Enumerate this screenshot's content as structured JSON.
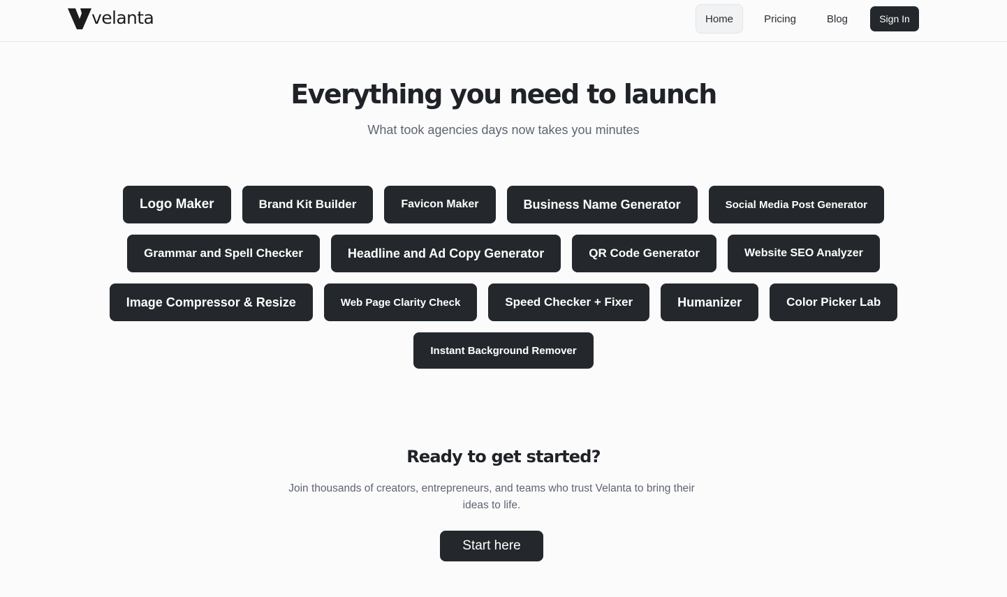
{
  "brand": {
    "name": "velanta",
    "logo_icon": "velanta-v-mark-icon"
  },
  "nav": {
    "home": "Home",
    "pricing": "Pricing",
    "blog": "Blog",
    "sign_in": "Sign In"
  },
  "hero": {
    "title": "Everything you need to launch",
    "subtitle": "What took agencies days now takes you minutes"
  },
  "tools": [
    "Logo Maker",
    "Brand Kit Builder",
    "Favicon Maker",
    "Business Name Generator",
    "Social Media Post Generator",
    "Grammar and Spell Checker",
    "Headline and Ad Copy Generator",
    "QR Code Generator",
    "Website SEO Analyzer",
    "Image Compressor & Resize",
    "Web Page Clarity Check",
    "Speed Checker + Fixer",
    "Humanizer",
    "Color Picker Lab",
    "Instant Background Remover"
  ],
  "cta": {
    "title": "Ready to get started?",
    "text": "Join thousands of creators, entrepreneurs, and teams who trust Velanta to bring their ideas to life.",
    "button": "Start here"
  },
  "colors": {
    "background": "#fbfbfc",
    "button_dark": "#24282c",
    "text_muted": "#5e6470"
  }
}
